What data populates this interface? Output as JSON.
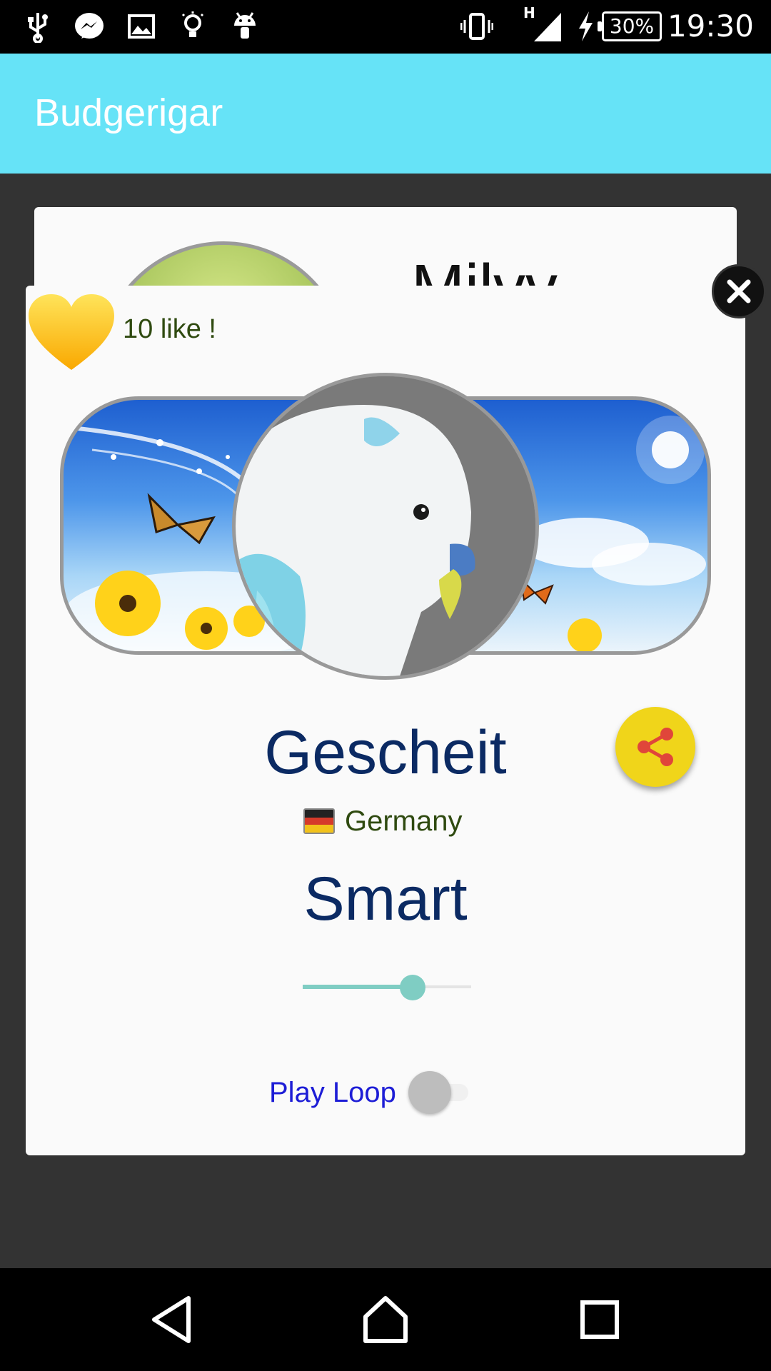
{
  "status_bar": {
    "time": "19:30",
    "battery": "30%",
    "network_type": "H",
    "icons": [
      "usb-icon",
      "messenger-icon",
      "gallery-icon",
      "bulb-icon",
      "android-icon",
      "vibrate-icon",
      "signal-icon",
      "charging-icon",
      "battery-icon"
    ]
  },
  "app_bar": {
    "title": "Budgerigar"
  },
  "background_card": {
    "name": "Milvv"
  },
  "dialog": {
    "likes": "10 like !",
    "word": "Gescheit",
    "country": "Germany",
    "translation": "Smart",
    "volume_level": 0.68,
    "play_loop_label": "Play Loop",
    "play_loop_on": false
  },
  "colors": {
    "app_bar": "#66e3f7",
    "word_text": "#0b2a63",
    "slider": "#7fcdc3",
    "share_button": "#f0d51a",
    "share_glyph": "#e0463a",
    "loop_label": "#1d1dd6"
  },
  "nav_bar": {
    "icons": [
      "back-icon",
      "home-icon",
      "recents-icon"
    ]
  }
}
